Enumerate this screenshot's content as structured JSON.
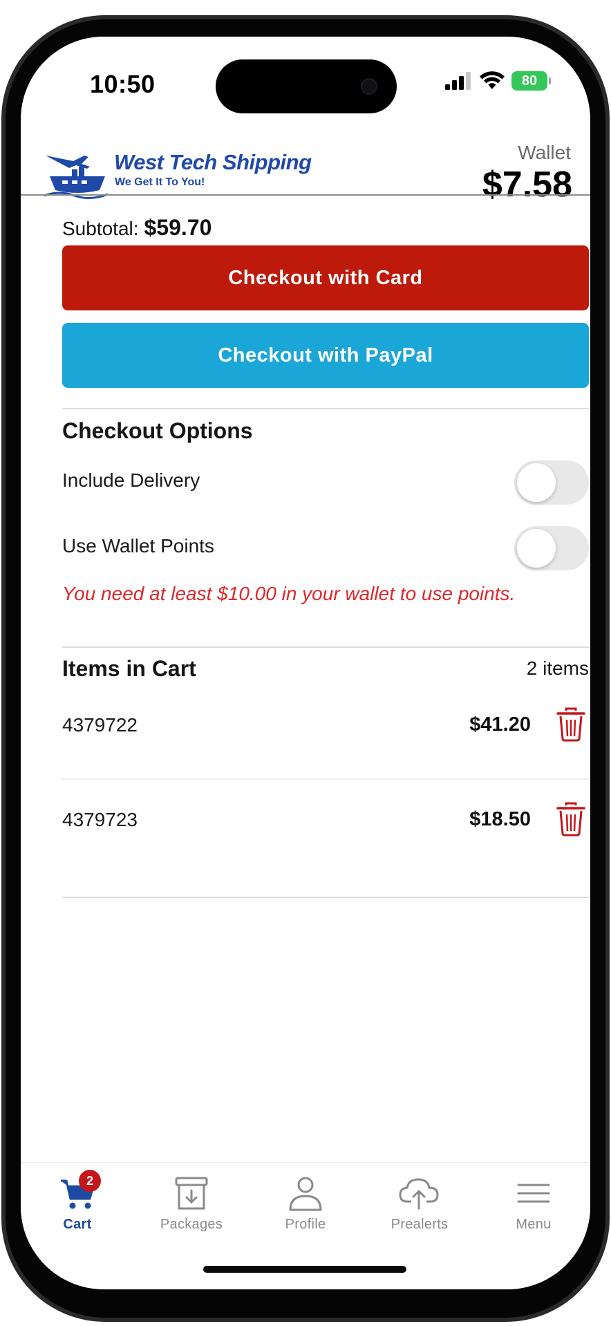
{
  "status_bar": {
    "time": "10:50",
    "battery": "80"
  },
  "header": {
    "brand_name": "West Tech Shipping",
    "brand_tagline": "We Get It To You!",
    "wallet_label": "Wallet",
    "wallet_amount": "$7.58"
  },
  "cart": {
    "subtotal_label": "Subtotal:",
    "subtotal_value": "$59.70",
    "checkout_card_label": "Checkout with Card",
    "checkout_paypal_label": "Checkout with PayPal"
  },
  "checkout_options": {
    "title": "Checkout Options",
    "options": [
      {
        "label": "Include Delivery",
        "enabled": false
      },
      {
        "label": "Use Wallet Points",
        "enabled": false
      }
    ],
    "warning": "You need at least $10.00 in your wallet to use points."
  },
  "items_section": {
    "title": "Items in Cart",
    "count_label": "2 items",
    "items": [
      {
        "id": "4379722",
        "price": "$41.20"
      },
      {
        "id": "4379723",
        "price": "$18.50"
      }
    ]
  },
  "tabbar": {
    "tabs": [
      {
        "label": "Cart",
        "icon": "cart-icon",
        "active": true,
        "badge": "2"
      },
      {
        "label": "Packages",
        "icon": "package-download-icon",
        "active": false
      },
      {
        "label": "Profile",
        "icon": "person-icon",
        "active": false
      },
      {
        "label": "Prealerts",
        "icon": "cloud-upload-icon",
        "active": false
      },
      {
        "label": "Menu",
        "icon": "hamburger-menu-icon",
        "active": false
      }
    ]
  },
  "colors": {
    "checkout_card": "#bd1a0c",
    "checkout_paypal": "#1ba6d8",
    "warning_text": "#e0262b",
    "active_tab": "#1e4aa0",
    "delete_icon": "#c4171b",
    "battery": "#34c759"
  }
}
